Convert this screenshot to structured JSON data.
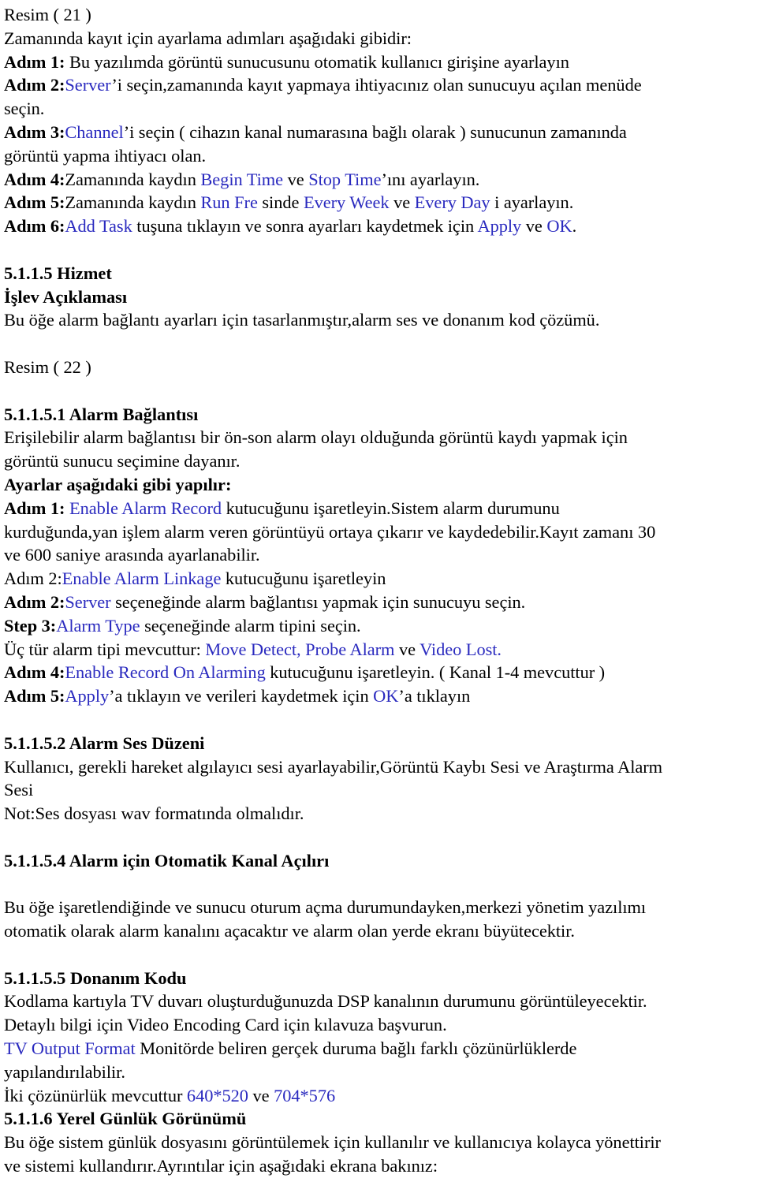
{
  "document": {
    "language": "Turkish",
    "page_kind": "scanned-manual-page",
    "colors": {
      "text": "#000000",
      "highlight_term": "#2a2abf",
      "background": "#ffffff"
    }
  },
  "figure_caption_1": "Resim ( 21 )",
  "intro_line": "Zamanında kayıt için ayarlama adımları aşağıdaki gibidir:",
  "steps_schedule": [
    {
      "label": "Adım 1:",
      "label_bold": true,
      "parts": [
        {
          "text": " Bu yazılımda görüntü sunucusunu otomatik kullanıcı girişine ayarlayın",
          "style": "plain"
        }
      ]
    },
    {
      "label": "Adım 2:",
      "label_bold": true,
      "parts": [
        {
          "text": "Server",
          "style": "blue"
        },
        {
          "text": "’i seçin,zamanında kayıt yapmaya ihtiyacınız olan sunucuyu açılan menüde",
          "style": "plain"
        }
      ]
    },
    {
      "label": "",
      "label_bold": false,
      "parts": [
        {
          "text": "seçin.",
          "style": "plain"
        }
      ]
    },
    {
      "label": "Adım 3:",
      "label_bold": true,
      "parts": [
        {
          "text": "Channel",
          "style": "blue"
        },
        {
          "text": "’i seçin ( cihazın kanal numarasına bağlı olarak ) sunucunun zamanında",
          "style": "plain"
        }
      ]
    },
    {
      "label": "",
      "label_bold": false,
      "parts": [
        {
          "text": "görüntü yapma ihtiyacı olan.",
          "style": "plain"
        }
      ]
    },
    {
      "label": "Adım 4:",
      "label_bold": true,
      "parts": [
        {
          "text": "Zamanında kaydın ",
          "style": "plain"
        },
        {
          "text": "Begin Time",
          "style": "blue"
        },
        {
          "text": " ve ",
          "style": "plain"
        },
        {
          "text": "Stop Time",
          "style": "blue"
        },
        {
          "text": "’ını ayarlayın.",
          "style": "plain"
        }
      ]
    },
    {
      "label": "Adım 5:",
      "label_bold": true,
      "parts": [
        {
          "text": "Zamanında kaydın ",
          "style": "plain"
        },
        {
          "text": "Run Fre",
          "style": "blue"
        },
        {
          "text": " sinde ",
          "style": "plain"
        },
        {
          "text": "Every Week",
          "style": "blue"
        },
        {
          "text": " ve ",
          "style": "plain"
        },
        {
          "text": "Every Day",
          "style": "blue"
        },
        {
          "text": " i ayarlayın.",
          "style": "plain"
        }
      ]
    },
    {
      "label": "Adım 6:",
      "label_bold": true,
      "parts": [
        {
          "text": "Add Task",
          "style": "blue"
        },
        {
          "text": " tuşuna tıklayın ve sonra ayarları kaydetmek için ",
          "style": "plain"
        },
        {
          "text": "Apply",
          "style": "blue"
        },
        {
          "text": " ve ",
          "style": "plain"
        },
        {
          "text": "OK",
          "style": "blue"
        },
        {
          "text": ".",
          "style": "plain"
        }
      ]
    }
  ],
  "section_hizmet": {
    "heading": "5.1.1.5 Hizmet",
    "subheading": "İşlev Açıklaması",
    "body": "Bu öğe alarm bağlantı ayarları için tasarlanmıştır,alarm ses ve donanım kod çözümü."
  },
  "figure_caption_2": "Resim ( 22 )",
  "section_alarm_baglantisi": {
    "heading": "5.1.1.5.1 Alarm Bağlantısı",
    "intro_line_1": "Erişilebilir alarm bağlantısı bir ön-son alarm olayı olduğunda görüntü kaydı yapmak için",
    "intro_line_2": "görüntü sunucu seçimine dayanır.",
    "settings_heading": "Ayarlar aşağıdaki gibi yapılır:",
    "steps": [
      {
        "label": "Adım 1:",
        "label_bold": true,
        "parts": [
          {
            "text": " ",
            "style": "plain"
          },
          {
            "text": "Enable Alarm Record",
            "style": "blue"
          },
          {
            "text": " kutucuğunu işaretleyin.Sistem alarm durumunu",
            "style": "plain"
          }
        ]
      },
      {
        "label": "",
        "label_bold": false,
        "parts": [
          {
            "text": "kurduğunda,yan işlem alarm veren görüntüyü ortaya çıkarır ve  kaydedebilir.Kayıt zamanı 30",
            "style": "plain"
          }
        ]
      },
      {
        "label": "",
        "label_bold": false,
        "parts": [
          {
            "text": "ve 600 saniye arasında ayarlanabilir.",
            "style": "plain"
          }
        ]
      },
      {
        "label": "Adım 2:",
        "label_bold": false,
        "parts": [
          {
            "text": "Enable Alarm Linkage",
            "style": "blue"
          },
          {
            "text": " kutucuğunu işaretleyin",
            "style": "plain"
          }
        ]
      },
      {
        "label": "Adım 2:",
        "label_bold": true,
        "parts": [
          {
            "text": "Server",
            "style": "blue"
          },
          {
            "text": " seçeneğinde alarm bağlantısı yapmak için sunucuyu seçin.",
            "style": "plain"
          }
        ]
      },
      {
        "label": "Step 3:",
        "label_bold": true,
        "parts": [
          {
            "text": "Alarm Type",
            "style": "blue"
          },
          {
            "text": " seçeneğinde alarm tipini seçin.",
            "style": "plain"
          }
        ]
      },
      {
        "label": "",
        "label_bold": false,
        "parts": [
          {
            "text": "Üç tür alarm tipi mevcuttur: ",
            "style": "plain"
          },
          {
            "text": "Move Detect, Probe Alarm",
            "style": "blue"
          },
          {
            "text": " ve ",
            "style": "plain"
          },
          {
            "text": "Video Lost.",
            "style": "blue"
          }
        ]
      },
      {
        "label": "Adım 4:",
        "label_bold": true,
        "parts": [
          {
            "text": "Enable Record On Alarming",
            "style": "blue"
          },
          {
            "text": " kutucuğunu işaretleyin. ( Kanal 1-4 mevcuttur )",
            "style": "plain"
          }
        ]
      },
      {
        "label": "Adım 5:",
        "label_bold": true,
        "parts": [
          {
            "text": "Apply",
            "style": "blue"
          },
          {
            "text": "’a tıklayın ve verileri kaydetmek için ",
            "style": "plain"
          },
          {
            "text": "OK",
            "style": "blue"
          },
          {
            "text": "’a tıklayın",
            "style": "plain"
          }
        ]
      }
    ]
  },
  "section_alarm_ses": {
    "heading": "5.1.1.5.2 Alarm Ses Düzeni",
    "body_line_1": "Kullanıcı, gerekli hareket algılayıcı sesi ayarlayabilir,Görüntü Kaybı Sesi ve Araştırma Alarm",
    "body_line_2": "Sesi",
    "note": "Not:Ses dosyası wav formatında olmalıdır."
  },
  "section_otomatik_kanal": {
    "heading": "5.1.1.5.4 Alarm için Otomatik Kanal Açılırı",
    "body_line_1": "Bu öğe işaretlendiğinde ve sunucu oturum açma durumundayken,merkezi yönetim yazılımı",
    "body_line_2": "otomatik olarak alarm kanalını açacaktır ve alarm olan yerde ekranı büyütecektir."
  },
  "section_donanim_kodu": {
    "heading": "5.1.1.5.5 Donanım Kodu",
    "body_line_1": "Kodlama kartıyla TV duvarı oluşturduğunuzda DSP kanalının durumunu görüntüleyecektir.",
    "body_line_2": "Detaylı bilgi için Video Encoding Card için kılavuza başvurun.",
    "tv_output_term": "TV Output Format",
    "tv_output_rest": " Monitörde beliren gerçek duruma bağlı farklı çözünürlüklerde",
    "tv_output_line_2": "yapılandırılabilir.",
    "resolution_prefix": "İki çözünürlük mevcuttur ",
    "resolution_1": "640*520",
    "resolution_join": " ve ",
    "resolution_2": "704*576"
  },
  "section_yerel_gunluk": {
    "heading": "5.1.1.6 Yerel Günlük Görünümü",
    "body_line_1": "Bu öğe sistem günlük dosyasını görüntülemek için kullanılır ve kullanıcıya kolayca yönettirir",
    "body_line_2": "ve sistemi kullandırır.Ayrıntılar için aşağıdaki ekrana bakınız:"
  }
}
